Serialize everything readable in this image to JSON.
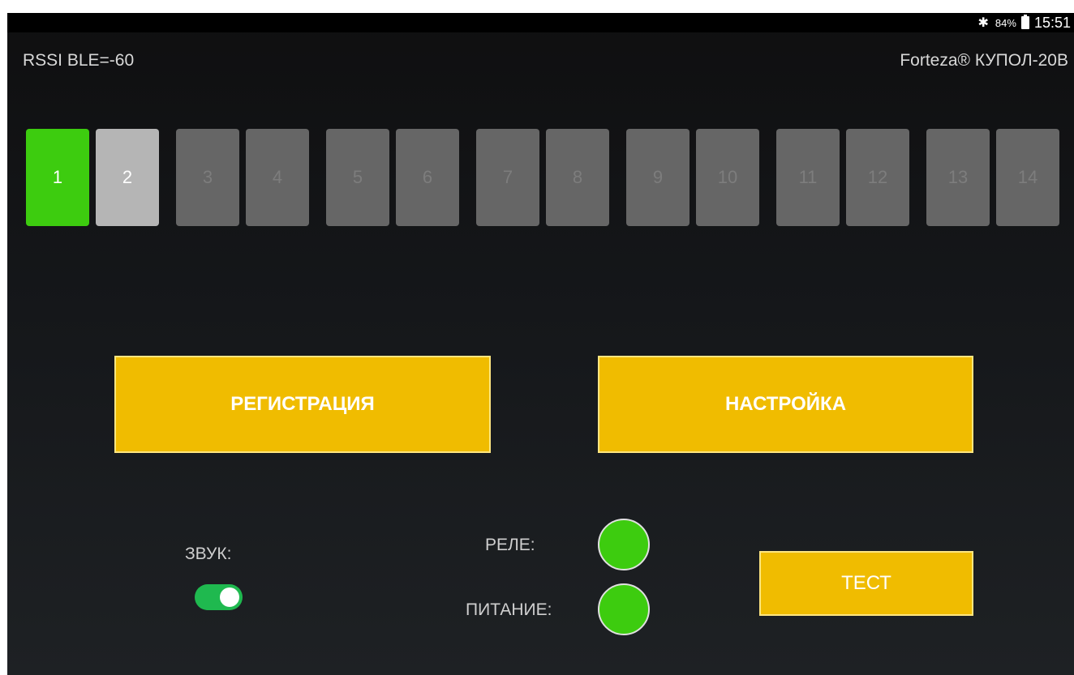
{
  "status_bar": {
    "bluetooth_icon": "bluetooth-icon",
    "battery_percent": "84%",
    "battery_icon": "battery-icon",
    "time": "15:51"
  },
  "header": {
    "rssi": "RSSI BLE=-60",
    "device": "Forteza® КУПОЛ-20В"
  },
  "channels": [
    {
      "label": "1",
      "state": "active"
    },
    {
      "label": "2",
      "state": "selected"
    },
    {
      "label": "3",
      "state": "inactive"
    },
    {
      "label": "4",
      "state": "inactive"
    },
    {
      "label": "5",
      "state": "inactive"
    },
    {
      "label": "6",
      "state": "inactive"
    },
    {
      "label": "7",
      "state": "inactive"
    },
    {
      "label": "8",
      "state": "inactive"
    },
    {
      "label": "9",
      "state": "inactive"
    },
    {
      "label": "10",
      "state": "inactive"
    },
    {
      "label": "11",
      "state": "inactive"
    },
    {
      "label": "12",
      "state": "inactive"
    },
    {
      "label": "13",
      "state": "inactive"
    },
    {
      "label": "14",
      "state": "inactive"
    }
  ],
  "buttons": {
    "registration": "РЕГИСТРАЦИЯ",
    "settings": "НАСТРОЙКА",
    "test": "ТЕСТ"
  },
  "sound": {
    "label": "ЗВУК:",
    "enabled": true
  },
  "indicators": {
    "relay_label": "РЕЛЕ:",
    "power_label": "ПИТАНИЕ:",
    "relay_on": true,
    "power_on": true
  },
  "colors": {
    "active_green": "#3dcc0f",
    "selected_gray": "#b5b5b5",
    "inactive_gray": "#666666",
    "button_yellow": "#f0bc00",
    "toggle_green": "#1fb94f"
  }
}
